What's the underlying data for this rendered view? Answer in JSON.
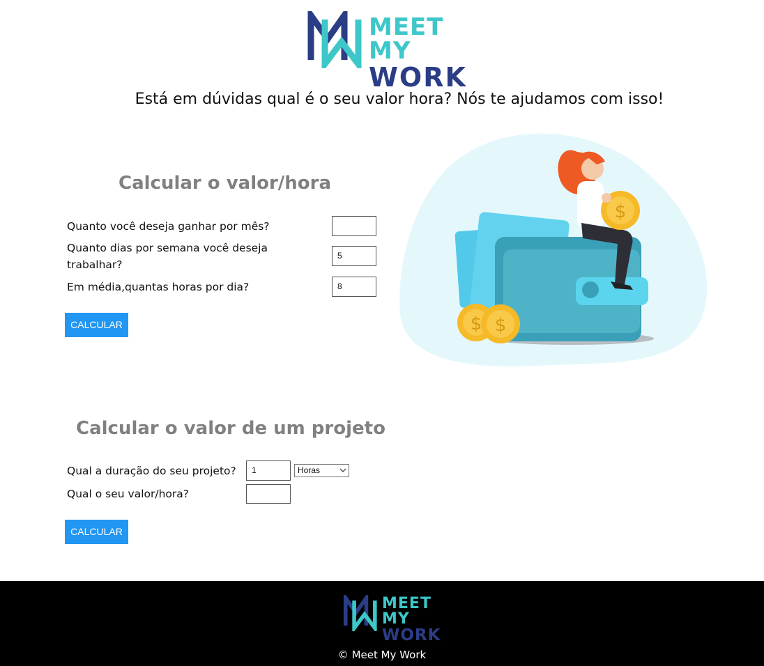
{
  "brand": {
    "line1": "MEET MY",
    "line2": "WORK",
    "teal": "#3ec7c9",
    "navy": "#2b3d85"
  },
  "tagline": "Está em dúvidas qual é o seu valor hora? Nós te ajudamos com isso!",
  "hourly": {
    "title": "Calcular o valor/hora",
    "q_month": "Quanto você deseja ganhar por mês?",
    "month_value": "",
    "q_days": "Quanto dias por semana você deseja trabalhar?",
    "days_value": "5",
    "q_hours": "Em média,quantas horas por dia?",
    "hours_value": "8",
    "button": "CALCULAR"
  },
  "project": {
    "title": "Calcular o valor de um projeto",
    "q_duration": "Qual a duração do seu projeto?",
    "duration_value": "1",
    "unit_selected": "Horas",
    "q_rate": "Qual o seu valor/hora?",
    "rate_value": "",
    "button": "CALCULAR"
  },
  "footer": {
    "copyright": "© Meet My Work"
  },
  "colors": {
    "button": "#2196f3",
    "heading": "#808080",
    "footer_bg": "#000000"
  },
  "icons": {
    "unit_select": "chevron-down-icon",
    "illustration": "wallet-woman-coins-illustration"
  }
}
